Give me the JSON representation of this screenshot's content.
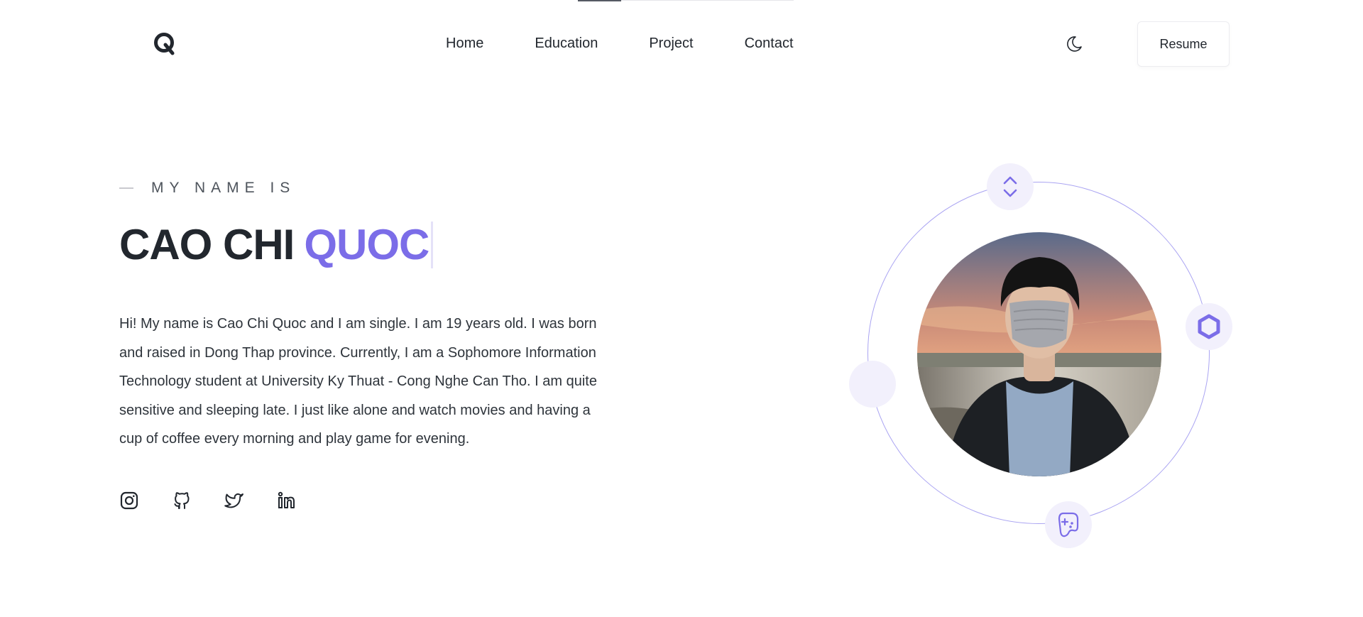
{
  "scroll_progress": 0.2,
  "header": {
    "logo_alt": "Q",
    "nav": [
      {
        "label": "Home"
      },
      {
        "label": "Education"
      },
      {
        "label": "Project"
      },
      {
        "label": "Contact"
      }
    ],
    "theme_toggle_icon": "moon-icon",
    "resume_label": "Resume"
  },
  "hero": {
    "eyebrow": "MY NAME IS",
    "name_first": "CAO CHI",
    "name_last": "QUOC",
    "bio": "Hi! My name is Cao Chi Quoc and I am single. I am 19 years old. I was born and raised in Dong Thap province. Currently, I am a Sophomore Information Technology student at University Ky Thuat - Cong Nghe Can Tho. I am quite sensitive and sleeping late. I just like alone and watch movies and having a cup of coffee every morning and play game for evening.",
    "socials": [
      {
        "icon": "instagram-icon"
      },
      {
        "icon": "github-icon"
      },
      {
        "icon": "twitter-icon"
      },
      {
        "icon": "linkedin-icon"
      }
    ]
  },
  "orbit": {
    "icons": [
      "code-arrows-icon",
      "hexagon-icon",
      "empty-bubble",
      "gamepad-icon"
    ]
  },
  "colors": {
    "accent": "#7b6de8",
    "text": "#22272e",
    "bubble": "#f2f0fc",
    "orbit": "#aaa4f2"
  }
}
